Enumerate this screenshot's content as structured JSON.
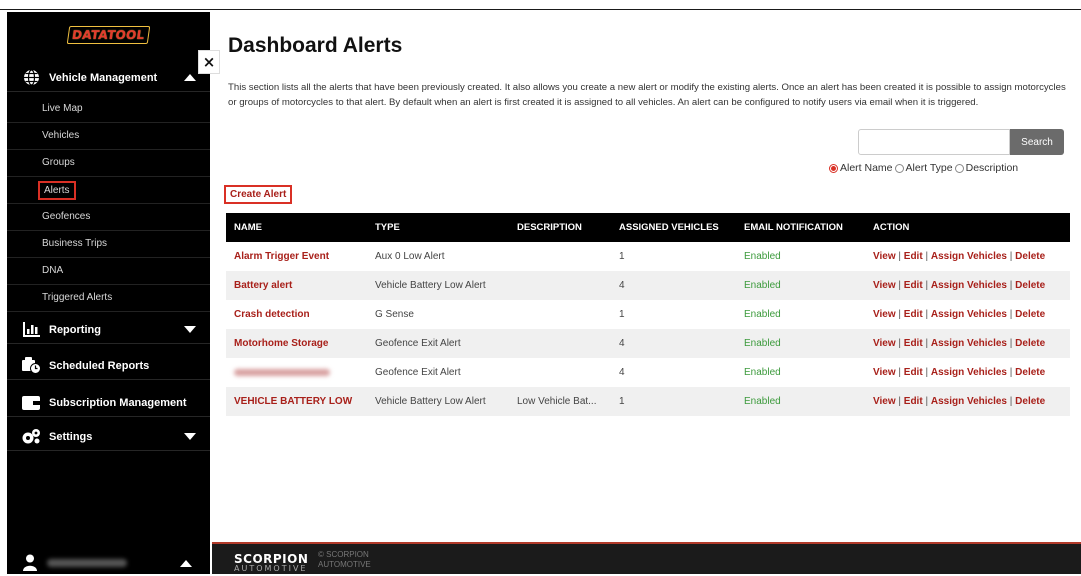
{
  "brand": {
    "logo": "DATATOOL"
  },
  "sidebar": {
    "vehicle_management": "Vehicle Management",
    "items": [
      {
        "label": "Live Map"
      },
      {
        "label": "Vehicles"
      },
      {
        "label": "Groups"
      },
      {
        "label": "Alerts"
      },
      {
        "label": "Geofences"
      },
      {
        "label": "Business Trips"
      },
      {
        "label": "DNA"
      },
      {
        "label": "Triggered Alerts"
      }
    ],
    "reporting": "Reporting",
    "scheduled_reports": "Scheduled Reports",
    "subscription_management": "Subscription Management",
    "settings": "Settings",
    "user_name": ""
  },
  "close_label": "×",
  "page": {
    "title": "Dashboard Alerts",
    "intro": "This section lists all the alerts that have been previously created. It also allows you create a new alert or modify the existing alerts. Once an alert has been created it is possible to assign motorcycles or groups of motorcycles to that alert. By default when an alert is first created it is assigned to all vehicles. An alert can be configured to notify users via email when it is triggered."
  },
  "search": {
    "value": "",
    "placeholder": "",
    "button": "Search",
    "options": [
      "Alert Name",
      "Alert Type",
      "Description"
    ],
    "selected": "Alert Name"
  },
  "create_alert": "Create Alert",
  "table": {
    "headers": [
      "NAME",
      "TYPE",
      "DESCRIPTION",
      "ASSIGNED VEHICLES",
      "EMAIL NOTIFICATION",
      "ACTION"
    ],
    "rows": [
      {
        "name": "Alarm Trigger Event",
        "type": "Aux 0 Low Alert",
        "description": "",
        "assigned": "1",
        "email": "Enabled"
      },
      {
        "name": "Battery alert",
        "type": "Vehicle Battery Low Alert",
        "description": "",
        "assigned": "4",
        "email": "Enabled"
      },
      {
        "name": "Crash detection",
        "type": "G Sense",
        "description": "",
        "assigned": "1",
        "email": "Enabled"
      },
      {
        "name": "Motorhome Storage",
        "type": "Geofence Exit Alert",
        "description": "",
        "assigned": "4",
        "email": "Enabled"
      },
      {
        "name": "",
        "type": "Geofence Exit Alert",
        "description": "",
        "assigned": "4",
        "email": "Enabled"
      },
      {
        "name": "VEHICLE BATTERY LOW",
        "type": "Vehicle Battery Low Alert",
        "description": "Low Vehicle Bat...",
        "assigned": "1",
        "email": "Enabled"
      }
    ],
    "actions": {
      "view": "View",
      "edit": "Edit",
      "assign": "Assign Vehicles",
      "delete": "Delete",
      "separator": "|"
    }
  },
  "footer": {
    "logo": "SCORPION",
    "logo_sub": "AUTOMOTIVE",
    "copyright_line1": "© SCORPION",
    "copyright_line2": "AUTOMOTIVE"
  },
  "colors": {
    "accent": "#a8201a",
    "highlight_border": "#d93025",
    "enabled": "#3c9a3c",
    "sidebar_bg": "#000000",
    "footer_bg": "#1b1b1b"
  }
}
